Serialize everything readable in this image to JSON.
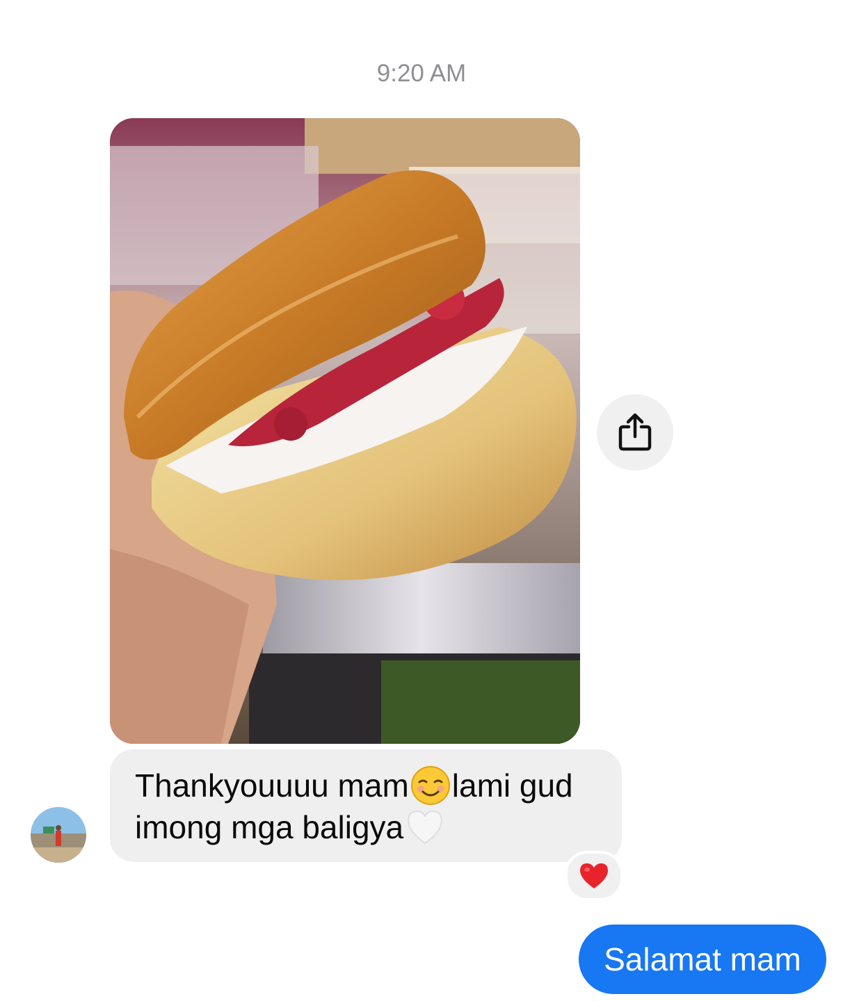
{
  "chat": {
    "timestamp": "9:20 AM",
    "incoming": {
      "text_part1": "Thankyouuuu mam",
      "emoji1": "smiling-face-emoji",
      "text_part2": "lami gud imong mga baligya",
      "emoji2": "white-heart-emoji",
      "reaction": "red-heart"
    },
    "outgoing": {
      "text": "Salamat mam"
    }
  },
  "colors": {
    "outgoing_bubble": "#1877f2",
    "incoming_bubble": "#efefef",
    "timestamp": "#8e8e93",
    "reaction_heart": "#e8232b"
  }
}
